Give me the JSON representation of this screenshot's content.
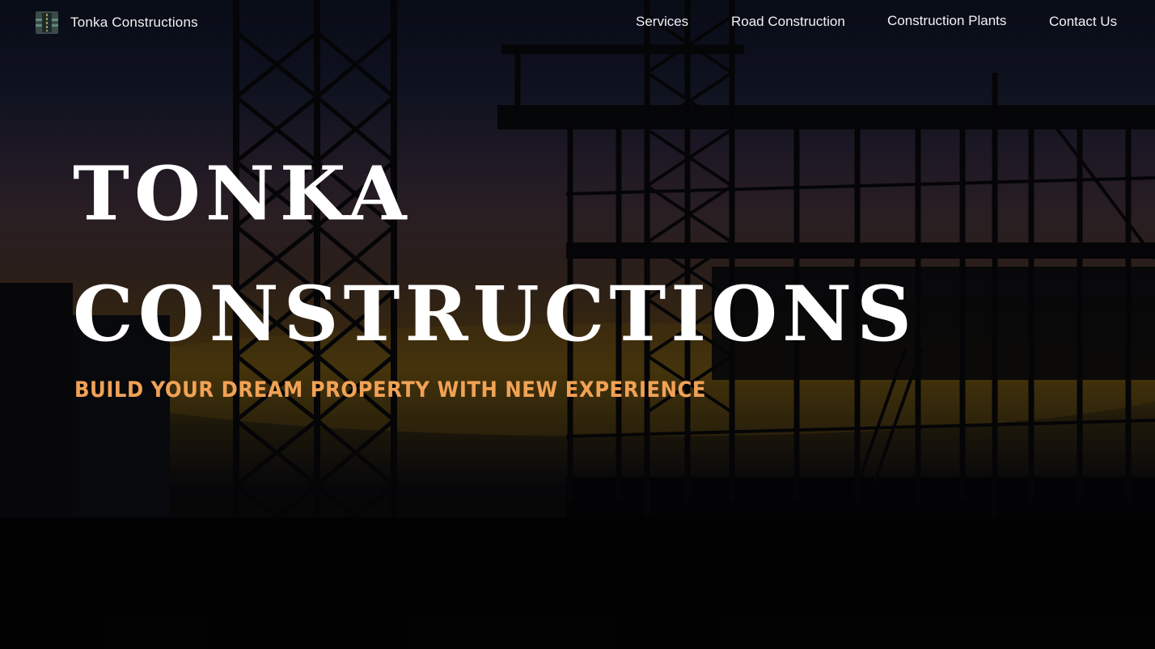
{
  "header": {
    "brand": "Tonka Constructions",
    "logo_icon": "construction-logo-icon",
    "nav": [
      {
        "label": "Services"
      },
      {
        "label": "Road Construction"
      },
      {
        "label": "Construction Plants"
      },
      {
        "label": "Contact Us"
      }
    ]
  },
  "hero": {
    "title_line1": "TONKA",
    "title_line2": "CONSTRUCTIONS",
    "tagline": "BUILD YOUR DREAM PROPERTY WITH NEW EXPERIENCE",
    "tagline_color": "#f1a255",
    "background": "construction-site-silhouette-at-dusk"
  }
}
